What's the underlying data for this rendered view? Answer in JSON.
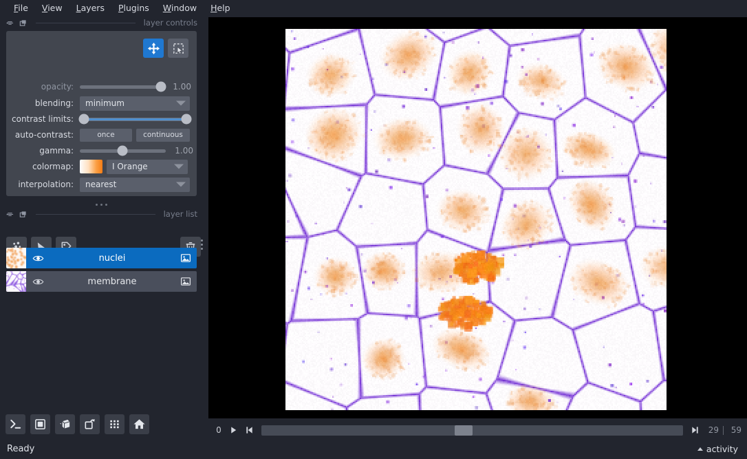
{
  "window": {
    "status": "Ready"
  },
  "menubar": {
    "items": [
      {
        "label": "File",
        "mnemonic": "F"
      },
      {
        "label": "View",
        "mnemonic": "V"
      },
      {
        "label": "Layers",
        "mnemonic": "L"
      },
      {
        "label": "Plugins",
        "mnemonic": "P"
      },
      {
        "label": "Window",
        "mnemonic": "W"
      },
      {
        "label": "Help",
        "mnemonic": "H"
      }
    ]
  },
  "layer_controls": {
    "dock_title": "layer controls",
    "tools": [
      {
        "name": "pan-zoom",
        "active": true
      },
      {
        "name": "transform",
        "active": false
      }
    ],
    "opacity": {
      "label": "opacity:",
      "value": "1.00",
      "percent": 100
    },
    "blending": {
      "label": "blending:",
      "value": "minimum"
    },
    "contrast_limits": {
      "label": "contrast limits:",
      "low_percent": 0,
      "high_percent": 100
    },
    "auto_contrast": {
      "label": "auto-contrast:",
      "once": "once",
      "continuous": "continuous"
    },
    "gamma": {
      "label": "gamma:",
      "value": "1.00",
      "percent": 50
    },
    "colormap": {
      "label": "colormap:",
      "value": "I Orange"
    },
    "interpolation": {
      "label": "interpolation:",
      "value": "nearest"
    }
  },
  "layer_list": {
    "dock_title": "layer list",
    "toolbar": [
      {
        "name": "new-points-button"
      },
      {
        "name": "new-shapes-button"
      },
      {
        "name": "new-labels-button"
      },
      {
        "name": "delete-layer-button"
      }
    ],
    "layers": [
      {
        "name": "nuclei",
        "selected": true,
        "visible": true,
        "type": "image"
      },
      {
        "name": "membrane",
        "selected": false,
        "visible": true,
        "type": "image"
      }
    ]
  },
  "viewer_buttons": [
    {
      "name": "console-button"
    },
    {
      "name": "ndisplay-2d-button"
    },
    {
      "name": "ndisplay-3d-button"
    },
    {
      "name": "roll-dims-button"
    },
    {
      "name": "grid-view-button"
    },
    {
      "name": "home-button"
    }
  ],
  "dim_slider": {
    "axis_label": "0",
    "current": "29",
    "max": "59",
    "percent": 48
  },
  "activity": {
    "label": "activity"
  },
  "colors": {
    "window_bg": "#22252e",
    "panel_bg": "#42464f",
    "widget_bg": "#5a5f6b",
    "accent_blue": "#1f78d1",
    "selected_row": "#0b6bbf",
    "canvas_bg": "#000000",
    "text": "#d8dbe2",
    "text_dim": "#8f95a1"
  }
}
